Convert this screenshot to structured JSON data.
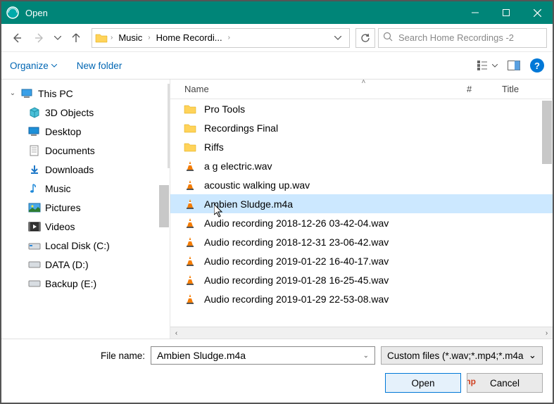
{
  "title": "Open",
  "breadcrumb": {
    "item1": "Music",
    "item2": "Home Recordi..."
  },
  "search": {
    "placeholder": "Search Home Recordings -2"
  },
  "toolbar": {
    "organize": "Organize",
    "newfolder": "New folder"
  },
  "sidebar": {
    "thispc": "This PC",
    "objects3d": "3D Objects",
    "desktop": "Desktop",
    "documents": "Documents",
    "downloads": "Downloads",
    "music": "Music",
    "pictures": "Pictures",
    "videos": "Videos",
    "localdisk": "Local Disk (C:)",
    "data": "DATA (D:)",
    "backup": "Backup (E:)"
  },
  "columns": {
    "name": "Name",
    "num": "#",
    "title": "Title"
  },
  "files": {
    "f0": "Pro Tools",
    "f1": "Recordings Final",
    "f2": "Riffs",
    "f3": "a g electric.wav",
    "f4": "acoustic walking up.wav",
    "f5": "Ambien Sludge.m4a",
    "f6": "Audio recording 2018-12-26 03-42-04.wav",
    "f7": "Audio recording 2018-12-31 23-06-42.wav",
    "f8": "Audio recording 2019-01-22 16-40-17.wav",
    "f9": "Audio recording 2019-01-28 16-25-45.wav",
    "f10": "Audio recording 2019-01-29 22-53-08.wav"
  },
  "filename": {
    "label": "File name:",
    "value": "Ambien Sludge.m4a"
  },
  "filetype": {
    "label": "Custom files (*.wav;*.mp4;*.m4a"
  },
  "buttons": {
    "open": "Open",
    "cancel": "Cancel"
  }
}
